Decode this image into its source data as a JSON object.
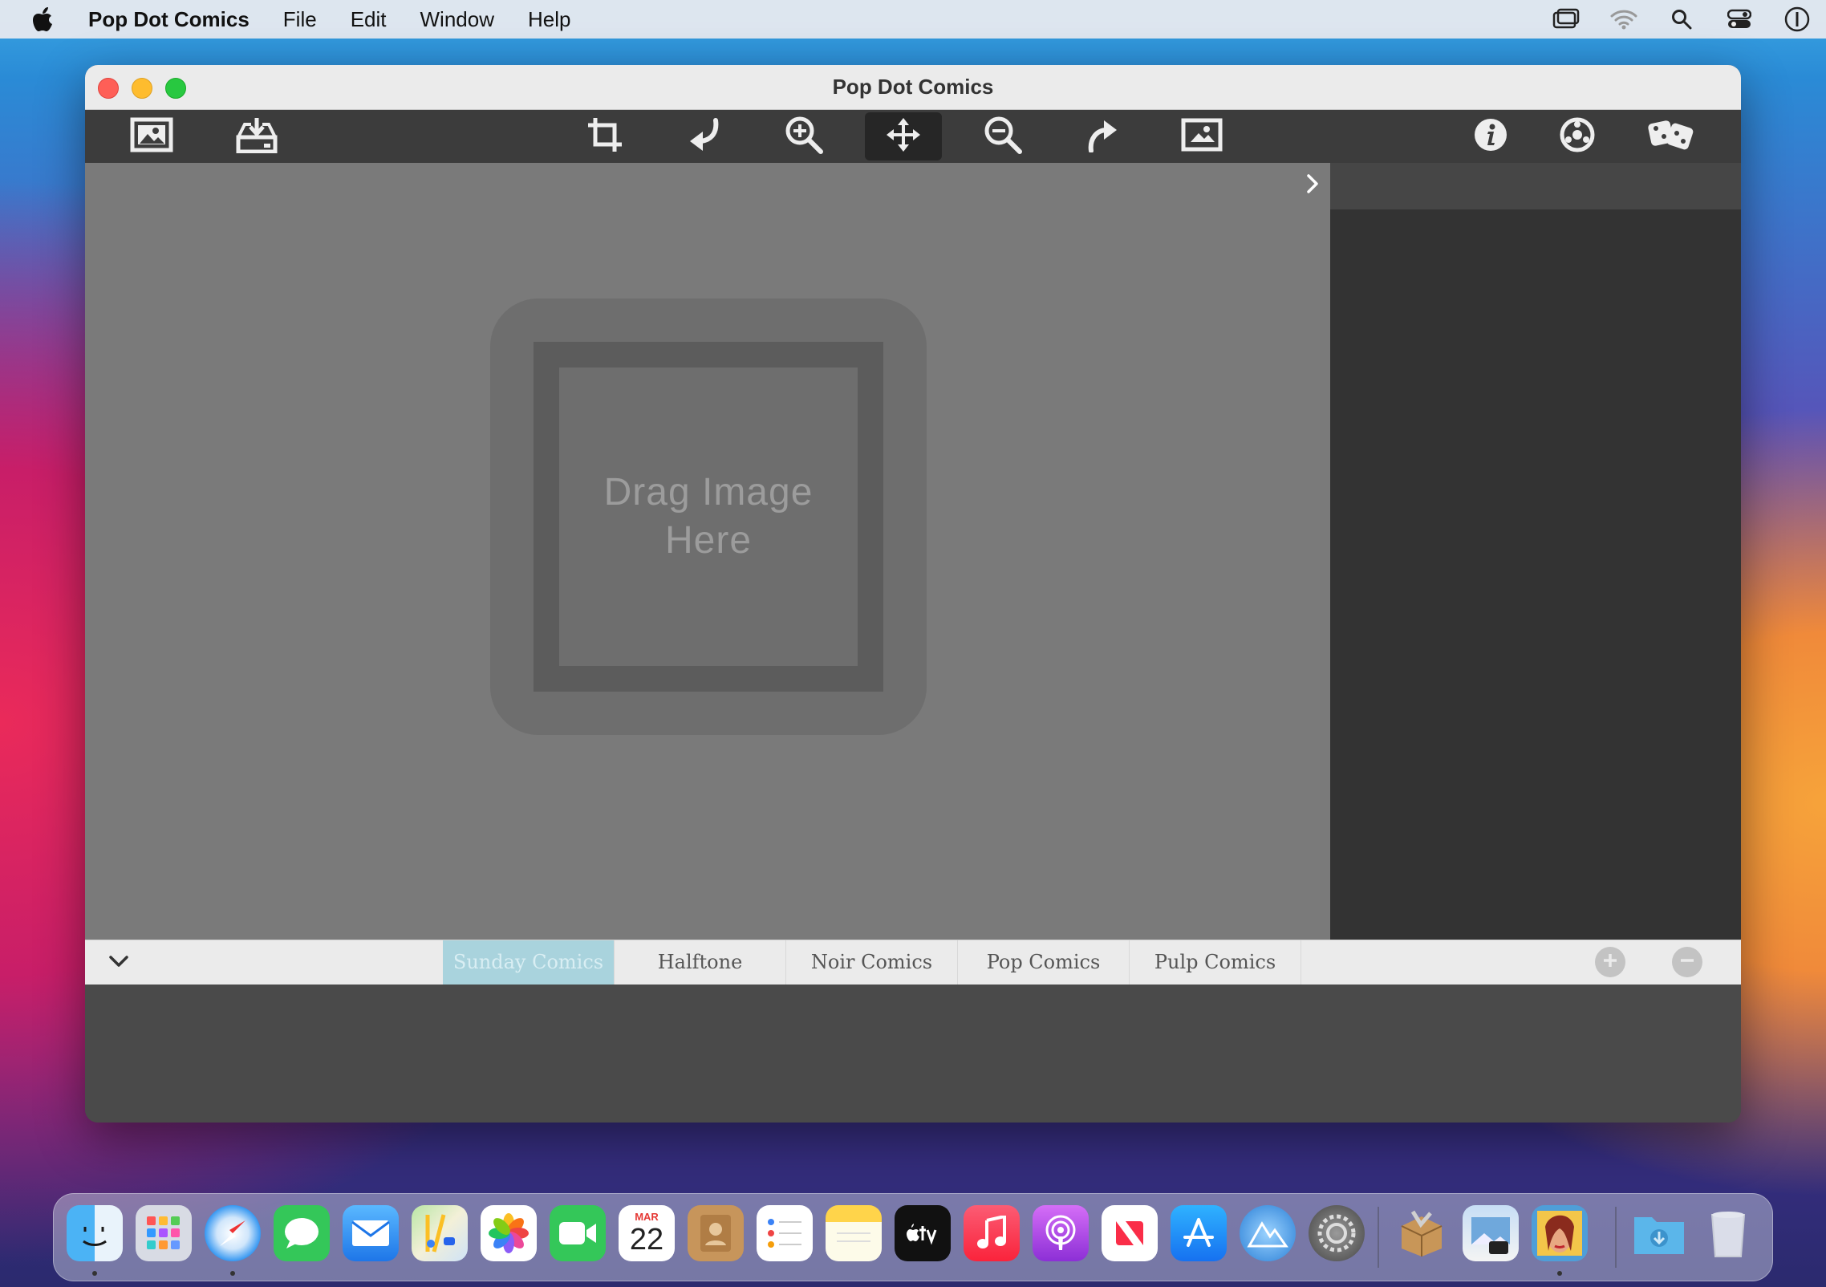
{
  "menubar": {
    "app_name": "Pop Dot Comics",
    "items": [
      "File",
      "Edit",
      "Window",
      "Help"
    ]
  },
  "window": {
    "title": "Pop Dot Comics"
  },
  "toolbar": {
    "buttons": [
      {
        "icon": "open-image-icon"
      },
      {
        "icon": "save-image-icon"
      },
      {
        "icon": "crop-icon"
      },
      {
        "icon": "rotate-left-icon"
      },
      {
        "icon": "zoom-in-icon"
      },
      {
        "icon": "move-icon",
        "active": true
      },
      {
        "icon": "zoom-out-icon"
      },
      {
        "icon": "rotate-right-icon"
      },
      {
        "icon": "fit-image-icon"
      },
      {
        "icon": "info-icon"
      },
      {
        "icon": "settings-icon"
      },
      {
        "icon": "randomize-icon"
      }
    ]
  },
  "canvas": {
    "drop_label_line1": "Drag Image",
    "drop_label_line2": "Here"
  },
  "tabs": {
    "items": [
      "Sunday Comics",
      "Halftone",
      "Noir Comics",
      "Pop Comics",
      "Pulp Comics"
    ],
    "selected": "Sunday Comics"
  },
  "calendar": {
    "month": "MAR",
    "day": "22"
  },
  "colors": {
    "toolbar_bg": "#3c3c3c",
    "canvas_bg": "#7a7a7a",
    "sidebar_bg": "#333333",
    "selected_tab": "#a9d3dd"
  }
}
